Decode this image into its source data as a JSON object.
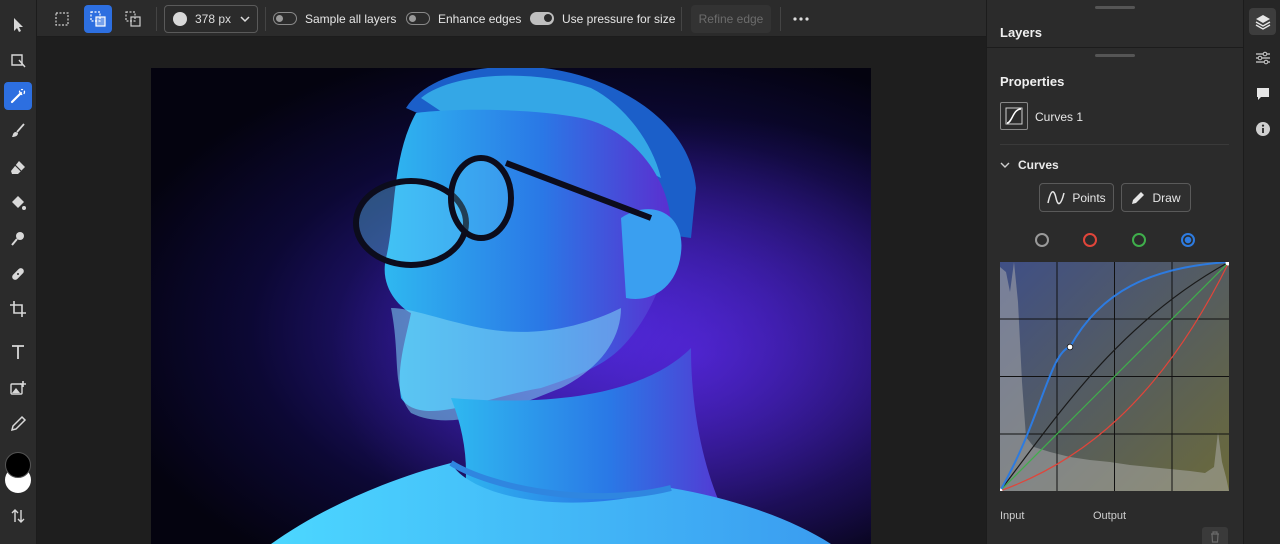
{
  "options_bar": {
    "brush_size": "378 px",
    "toggles": [
      {
        "label": "Sample all layers",
        "on": false
      },
      {
        "label": "Enhance edges",
        "on": false
      },
      {
        "label": "Use pressure for size",
        "on": true
      }
    ],
    "refine_edge_label": "Refine edge"
  },
  "tools": [
    "move-tool",
    "transform-tool",
    "quick-selection-tool",
    "brush-tool",
    "eraser-tool",
    "paint-bucket-tool",
    "clone-stamp-tool",
    "healing-brush-tool",
    "crop-tool",
    "type-tool",
    "place-image-tool",
    "eyedropper-tool"
  ],
  "colors": {
    "foreground": "#000000",
    "background": "#ffffff",
    "accent": "#2d6fe0"
  },
  "layers_panel": {
    "title": "Layers"
  },
  "properties_panel": {
    "title": "Properties",
    "layer_name": "Curves 1",
    "section_title": "Curves",
    "mode_buttons": [
      "Points",
      "Draw"
    ],
    "channels": [
      "rgb",
      "red",
      "green",
      "blue"
    ],
    "selected_channel": "blue",
    "input_label": "Input",
    "output_label": "Output"
  },
  "right_strip": [
    "layers-icon",
    "adjustments-icon",
    "comments-icon",
    "info-icon"
  ]
}
